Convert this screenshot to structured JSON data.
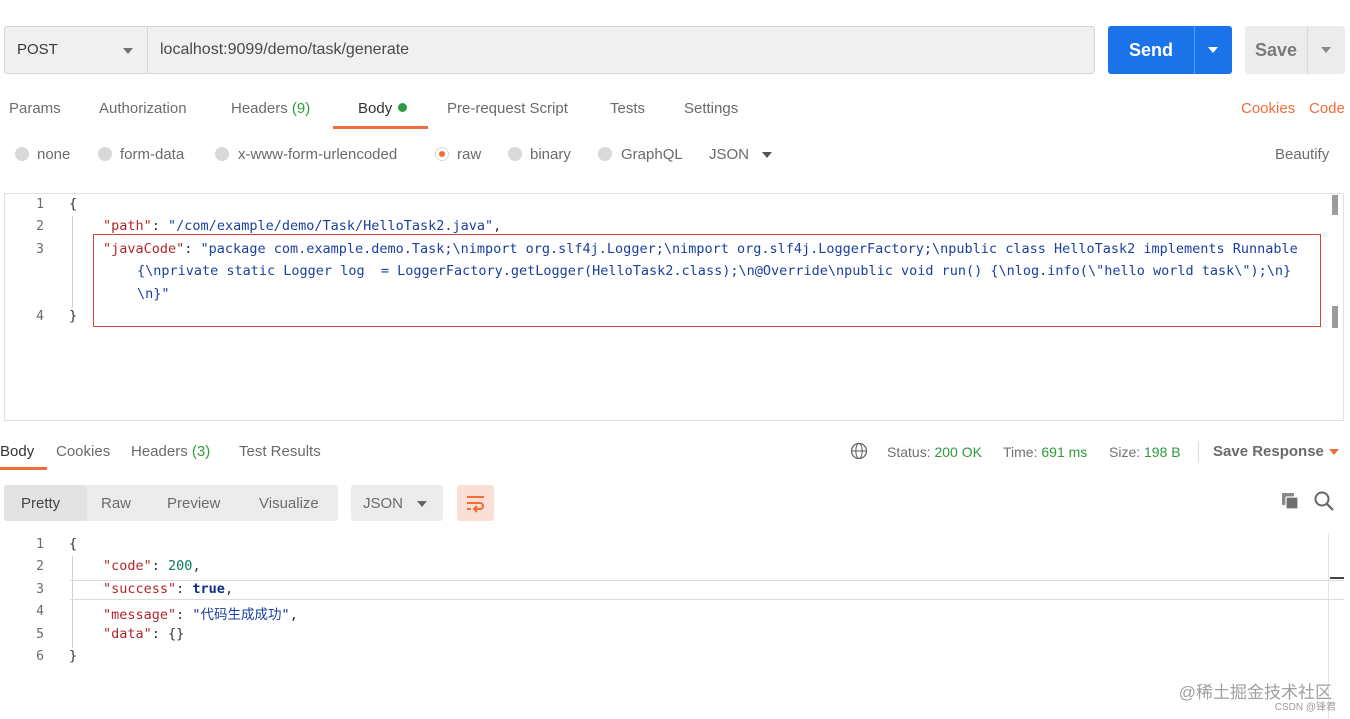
{
  "request": {
    "method": "POST",
    "url": "localhost:9099/demo/task/generate",
    "send_label": "Send",
    "save_label": "Save"
  },
  "request_tabs": {
    "params": "Params",
    "authorization": "Authorization",
    "headers": "Headers",
    "headers_count": "(9)",
    "body": "Body",
    "prerequest": "Pre-request Script",
    "tests": "Tests",
    "settings": "Settings",
    "cookies": "Cookies",
    "code": "Code"
  },
  "body_modes": {
    "none": "none",
    "form_data": "form-data",
    "urlencoded": "x-www-form-urlencoded",
    "raw": "raw",
    "binary": "binary",
    "graphql": "GraphQL",
    "format": "JSON",
    "beautify": "Beautify"
  },
  "request_body": {
    "line_numbers": [
      "1",
      "2",
      "3",
      "4"
    ],
    "open_brace": "{",
    "path_key": "\"path\"",
    "path_value": "\"/com/example/demo/Task/HelloTask2.java\"",
    "javacode_key": "\"javaCode\"",
    "javacode_value_line1": "\"package com.example.demo.Task;\\nimport org.slf4j.Logger;\\nimport org.slf4j.LoggerFactory;\\npublic class HelloTask2 implements Runnable",
    "javacode_value_line2": "{\\nprivate static Logger log  = LoggerFactory.getLogger(HelloTask2.class);\\n@Override\\npublic void run() {\\nlog.info(\\\"hello world task\\\");\\n}",
    "javacode_value_line3": "\\n}\"",
    "close_brace": "}"
  },
  "response_tabs": {
    "body": "Body",
    "cookies": "Cookies",
    "headers": "Headers",
    "headers_count": "(3)",
    "test_results": "Test Results"
  },
  "response_status": {
    "status_label": "Status:",
    "status_value": "200 OK",
    "time_label": "Time:",
    "time_value": "691 ms",
    "size_label": "Size:",
    "size_value": "198 B",
    "save_response": "Save Response"
  },
  "response_view": {
    "pretty": "Pretty",
    "raw": "Raw",
    "preview": "Preview",
    "visualize": "Visualize",
    "format": "JSON"
  },
  "response_body": {
    "line_numbers": [
      "1",
      "2",
      "3",
      "4",
      "5",
      "6"
    ],
    "open_brace": "{",
    "code_key": "\"code\"",
    "code_value": "200",
    "success_key": "\"success\"",
    "success_value": "true",
    "message_key": "\"message\"",
    "message_value": "\"代码生成成功\"",
    "data_key": "\"data\"",
    "data_value": "{}",
    "close_brace": "}"
  },
  "watermark": {
    "line1": "@稀土掘金技术社区",
    "line2": "CSDN @锋君"
  },
  "colors": {
    "accent_orange": "#f26b3a",
    "send_blue": "#1a73e8",
    "success_green": "#2e9a3c"
  }
}
